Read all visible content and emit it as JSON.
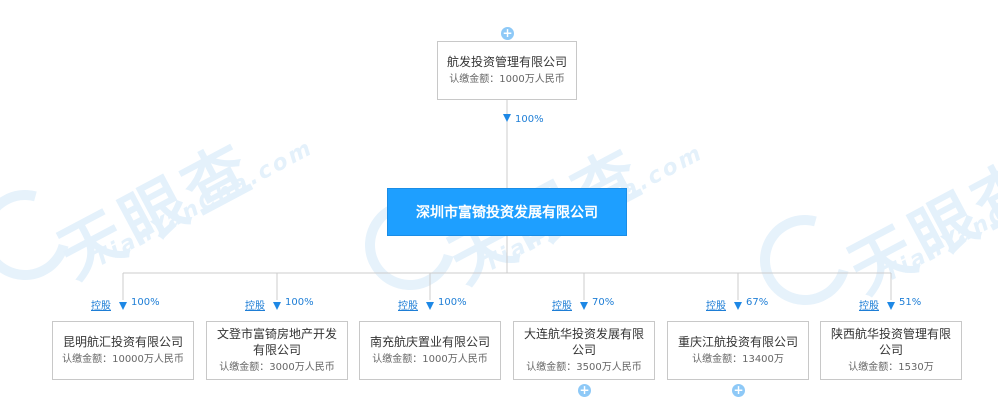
{
  "watermark": {
    "brand": "天眼查",
    "domain": "TianYanCha.com"
  },
  "colors": {
    "primary": "#1e9fff",
    "line": "#cccccc",
    "percent": "#1e7ed6"
  },
  "parent": {
    "name": "航发投资管理有限公司",
    "capital": "认缴金额：1000万人民币",
    "percent": "100%"
  },
  "center": {
    "name": "深圳市富锜投资发展有限公司"
  },
  "children": [
    {
      "tag": "控股",
      "percent": "100%",
      "name": "昆明航汇投资有限公司",
      "capital": "认缴金额：10000万人民币"
    },
    {
      "tag": "控股",
      "percent": "100%",
      "name": "文登市富锜房地产开发有限公司",
      "capital": "认缴金额：3000万人民币"
    },
    {
      "tag": "控股",
      "percent": "100%",
      "name": "南充航庆置业有限公司",
      "capital": "认缴金额：1000万人民币"
    },
    {
      "tag": "控股",
      "percent": "70%",
      "name": "大连航华投资发展有限公司",
      "capital": "认缴金额：3500万人民币"
    },
    {
      "tag": "控股",
      "percent": "67%",
      "name": "重庆江航投资有限公司",
      "capital": "认缴金额：13400万"
    },
    {
      "tag": "控股",
      "percent": "51%",
      "name": "陕西航华投资管理有限公司",
      "capital": "认缴金额：1530万"
    }
  ],
  "expand_icon": "plus-circle-icon"
}
